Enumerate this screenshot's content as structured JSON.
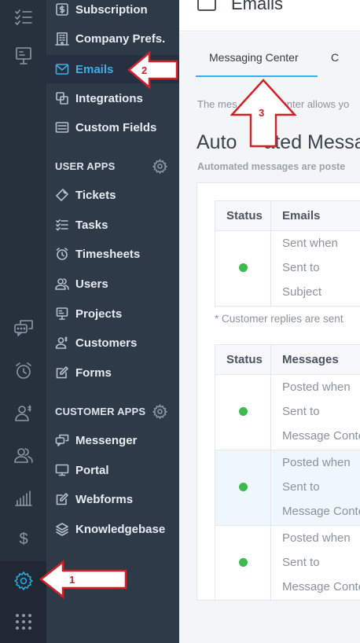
{
  "sidebar": {
    "items_top": [
      {
        "label": "Subscription",
        "icon": "dollar-icon"
      },
      {
        "label": "Company Prefs.",
        "icon": "building-icon"
      },
      {
        "label": "Emails",
        "icon": "envelope-icon",
        "active": true
      },
      {
        "label": "Integrations",
        "icon": "integrations-icon"
      },
      {
        "label": "Custom Fields",
        "icon": "custom-fields-icon"
      }
    ],
    "user_apps_heading": "USER APPS",
    "user_apps": [
      {
        "label": "Tickets",
        "icon": "ticket-icon"
      },
      {
        "label": "Tasks",
        "icon": "tasks-icon"
      },
      {
        "label": "Timesheets",
        "icon": "clock-icon"
      },
      {
        "label": "Users",
        "icon": "users-icon"
      },
      {
        "label": "Projects",
        "icon": "projects-icon"
      },
      {
        "label": "Customers",
        "icon": "customers-icon"
      },
      {
        "label": "Forms",
        "icon": "forms-icon"
      }
    ],
    "customer_apps_heading": "CUSTOMER APPS",
    "customer_apps": [
      {
        "label": "Messenger",
        "icon": "messenger-icon"
      },
      {
        "label": "Portal",
        "icon": "monitor-icon"
      },
      {
        "label": "Webforms",
        "icon": "webforms-icon"
      },
      {
        "label": "Knowledgebase",
        "icon": "layers-icon"
      }
    ]
  },
  "rail": {
    "icons": [
      "tasks-icon",
      "presentation-icon",
      "chat-icon",
      "alarm-clock-icon",
      "user-dollar-icon",
      "users-icon",
      "bar-chart-icon",
      "dollar-icon",
      "settings-gear-icon",
      "apps-grid-icon"
    ],
    "dollar_symbol": "$"
  },
  "header": {
    "title": "Emails"
  },
  "tabs": [
    {
      "label": "Messaging Center",
      "active": true
    },
    {
      "label": "C"
    }
  ],
  "description": "The mes",
  "description_tail": "enter allows yo",
  "section": {
    "title": "Auto",
    "title_tail": "ated Messa",
    "subtitle": "Automated messages are poste"
  },
  "emails_table": {
    "headers": [
      "Status",
      "Emails"
    ],
    "rows": [
      {
        "status": "active",
        "lines": [
          "Sent when",
          "Sent to",
          "Subject"
        ]
      }
    ]
  },
  "note": "* Customer replies are sent",
  "messages_table": {
    "headers": [
      "Status",
      "Messages"
    ],
    "rows": [
      {
        "status": "active",
        "lines": [
          "Posted when",
          "Sent to",
          "Message Conte"
        ]
      },
      {
        "status": "active",
        "lines": [
          "Posted when",
          "Sent to",
          "Message Conte"
        ],
        "highlighted": true
      },
      {
        "status": "active",
        "lines": [
          "Posted when",
          "Sent to",
          "Message Conte"
        ]
      }
    ]
  },
  "annotations": {
    "step1": "1",
    "step2": "2",
    "step3": "3",
    "color": "#d42027"
  },
  "colors": {
    "accent": "#3daee9",
    "status_active": "#3dba4e",
    "sidebar": "#2f3a48",
    "rail": "#27313e"
  }
}
